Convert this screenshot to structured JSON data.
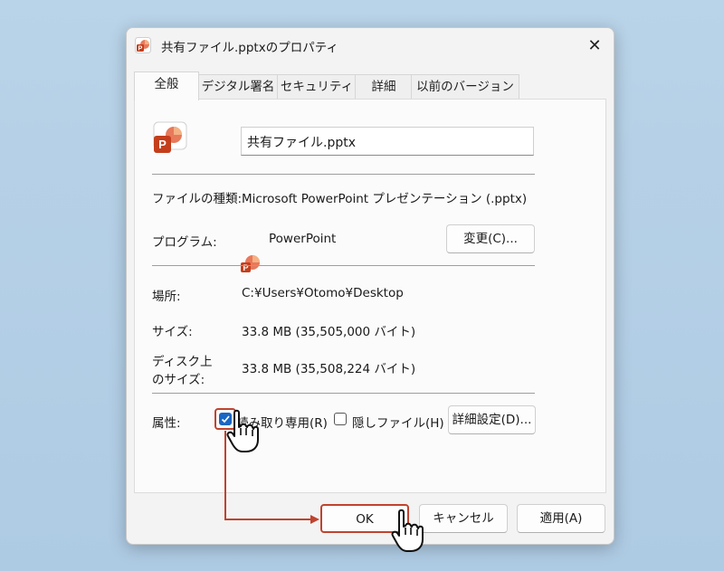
{
  "window": {
    "title": "共有ファイル.pptxのプロパティ"
  },
  "tabs": [
    "全般",
    "デジタル署名",
    "セキュリティ",
    "詳細",
    "以前のバージョン"
  ],
  "general": {
    "file_name": "共有ファイル.pptx",
    "type_label": "ファイルの種類:",
    "type_value": "Microsoft PowerPoint プレゼンテーション (.pptx)",
    "program_label": "プログラム:",
    "program_value": "PowerPoint",
    "change_button": "変更(C)...",
    "location_label": "場所:",
    "location_value": "C:¥Users¥Otomo¥Desktop",
    "size_label": "サイズ:",
    "size_value": "33.8 MB (35,505,000 バイト)",
    "disk_size_label_1": "ディスク上",
    "disk_size_label_2": "のサイズ:",
    "disk_size_value": "33.8 MB (35,508,224 バイト)",
    "attributes_label": "属性:",
    "readonly_label": "読み取り専用(R)",
    "readonly_checked": true,
    "hidden_label": "隠しファイル(H)",
    "hidden_checked": false,
    "advanced_button": "詳細設定(D)..."
  },
  "footer": {
    "ok": "OK",
    "cancel": "キャンセル",
    "apply": "適用(A)"
  },
  "colors": {
    "accent": "#1a66c4",
    "highlight": "#c0432e",
    "powerpoint": "#c43e1c"
  },
  "icons": {
    "close": "close-icon",
    "powerpoint": "powerpoint-icon",
    "pointer": "hand-pointer-icon"
  }
}
